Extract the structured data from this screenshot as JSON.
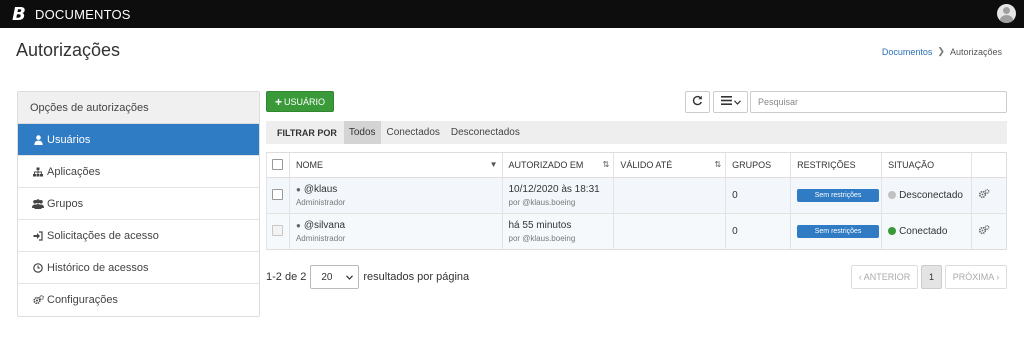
{
  "app": {
    "logo": "B",
    "title": "DOCUMENTOS"
  },
  "page": {
    "title": "Autorizações"
  },
  "breadcrumb": {
    "link": "Documentos",
    "current": "Autorizações"
  },
  "sidebar": {
    "header": "Opções de autorizações",
    "items": [
      {
        "label": "Usuários",
        "icon": "user-icon"
      },
      {
        "label": "Aplicações",
        "icon": "sitemap-icon"
      },
      {
        "label": "Grupos",
        "icon": "users-icon"
      },
      {
        "label": "Solicitações de acesso",
        "icon": "sign-in-icon"
      },
      {
        "label": "Histórico de acessos",
        "icon": "clock-icon"
      },
      {
        "label": "Configurações",
        "icon": "gears-icon"
      }
    ]
  },
  "toolbar": {
    "add_label": "USUÁRIO",
    "search_placeholder": "Pesquisar"
  },
  "filter": {
    "label": "FILTRAR POR",
    "tabs": [
      "Todos",
      "Conectados",
      "Desconectados"
    ],
    "active": "Todos"
  },
  "table": {
    "columns": [
      "NOME",
      "AUTORIZADO EM",
      "VÁLIDO ATÉ",
      "GRUPOS",
      "RESTRIÇÕES",
      "SITUAÇÃO"
    ],
    "rows": [
      {
        "name": "@klaus",
        "role": "Administrador",
        "authorized_at": "10/12/2020 às 18:31",
        "authorized_by": "por @klaus.boeing",
        "valid_until": "",
        "groups": "0",
        "restrictions": "Sem restrições",
        "status": "Desconectado",
        "status_color": "#c2c2c2"
      },
      {
        "name": "@silvana",
        "role": "Administrador",
        "authorized_at": "há 55 minutos",
        "authorized_by": "por @klaus.boeing",
        "valid_until": "",
        "groups": "0",
        "restrictions": "Sem restrições",
        "status": "Conectado",
        "status_color": "#3a9a3a"
      }
    ]
  },
  "footer": {
    "range": "1-2 de 2",
    "page_size": "20",
    "per_page_label": "resultados por página",
    "prev": "‹ ANTERIOR",
    "page": "1",
    "next": "PRÓXIMA ›"
  },
  "colors": {
    "accent": "#2f7bc4",
    "success": "#3a9a3a",
    "topbar": "#0d0d0d"
  }
}
